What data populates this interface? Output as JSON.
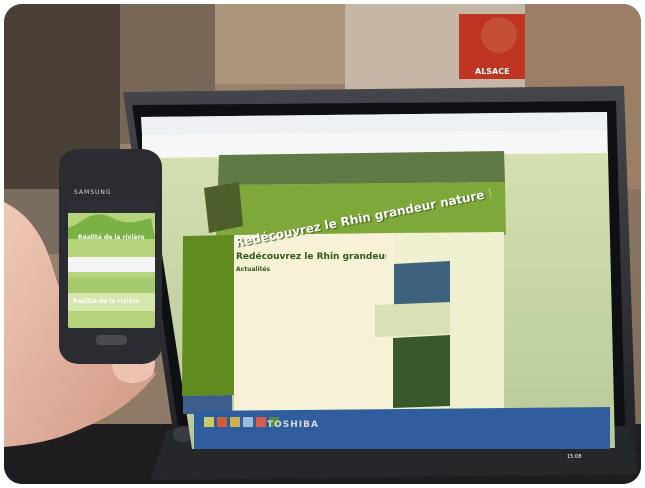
{
  "scene": {
    "page_title": "Redécouvrez le Rhin grandeur nature !",
    "section_title": "Redécouvrez le Rhin grandeur nature",
    "section_subtitle": "Actualités",
    "laptop_brand": "TOSHIBA",
    "phone_brand": "SAMSUNG",
    "phone_link_top": "Réalité de la rivière",
    "phone_link_bottom": "Réalité de la rivière",
    "poster_text": "ALSACE",
    "taskbar_clock": "15:08"
  },
  "colors": {
    "web_green": "#7fa83a",
    "sidebar_green": "#5f8b1f",
    "screen_bg": "#c8d39a",
    "laptop_body": "#2c2d31",
    "taskbar_blue": "#2f5d9e"
  },
  "icons": {
    "phone": "smartphone-icon",
    "laptop": "laptop-icon"
  }
}
